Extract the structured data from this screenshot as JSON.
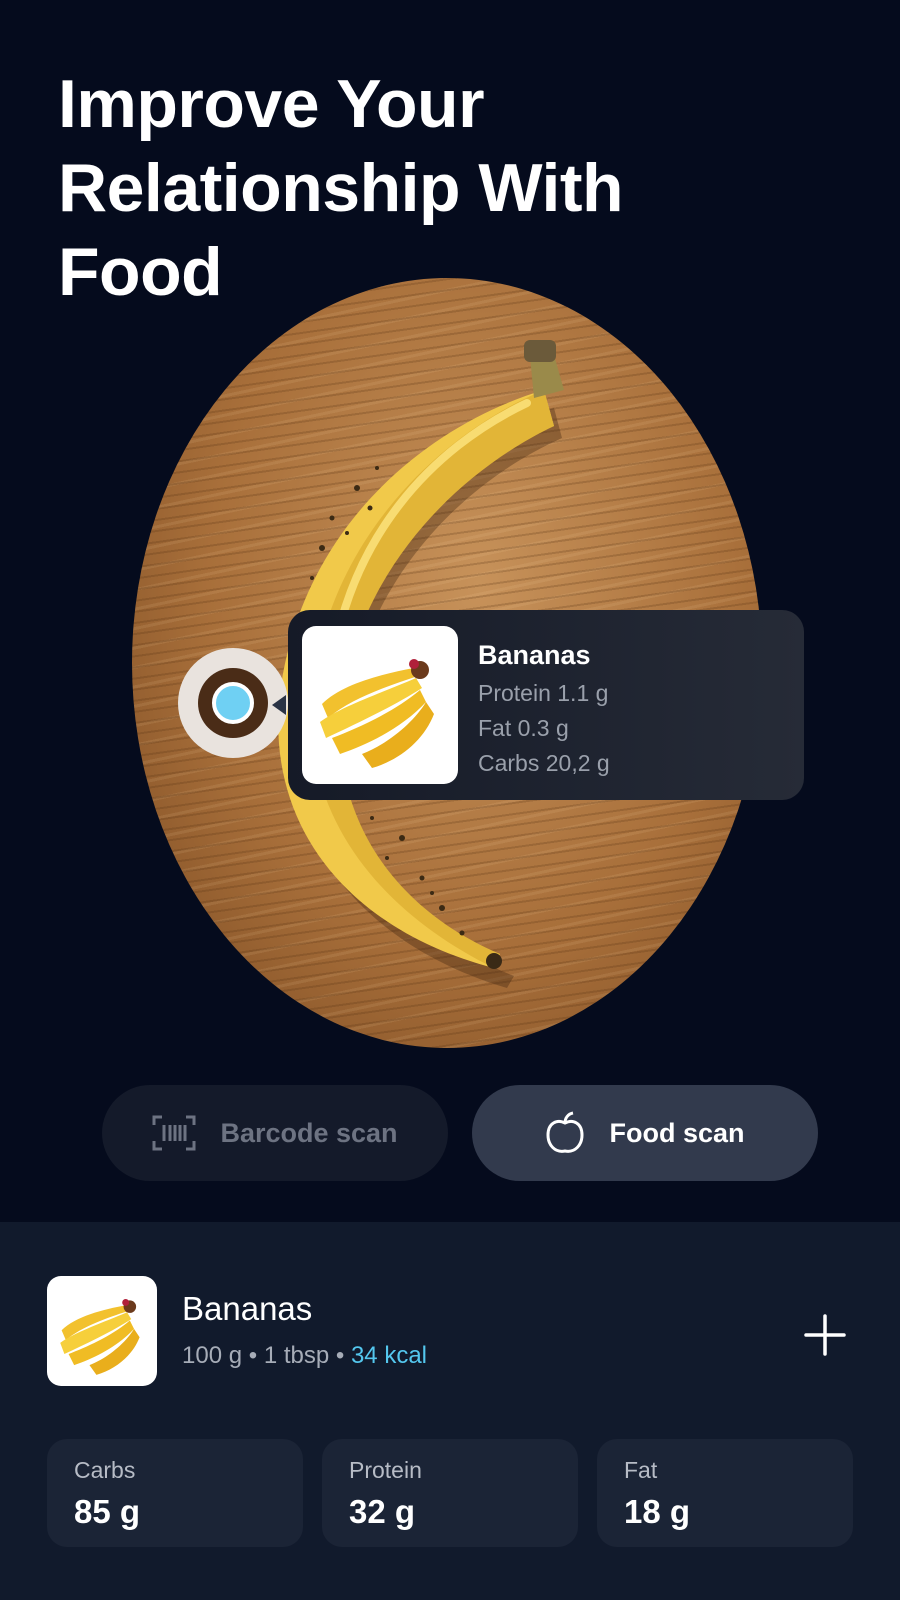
{
  "headline": {
    "line1": "Improve Your",
    "line2": "Relationship With",
    "line3": "Food"
  },
  "photo": {
    "subject_icon": "banana-photo"
  },
  "popup": {
    "name": "Bananas",
    "protein": "Protein 1.1 g",
    "fat": "Fat 0.3 g",
    "carbs": "Carbs 20,2 g",
    "thumb_icon": "bananas-bunch-icon"
  },
  "scan_modes": {
    "barcode": {
      "label": "Barcode scan",
      "icon": "barcode-scan-icon",
      "active": false
    },
    "food": {
      "label": "Food scan",
      "icon": "apple-icon",
      "active": true
    }
  },
  "item": {
    "name": "Bananas",
    "weight": "100 g",
    "portion": "1 tbsp",
    "kcal": "34 kcal",
    "separator": "•",
    "add_icon": "plus-icon"
  },
  "macros": [
    {
      "label": "Carbs",
      "value": "85 g"
    },
    {
      "label": "Protein",
      "value": "32 g"
    },
    {
      "label": "Fat",
      "value": "18 g"
    }
  ],
  "colors": {
    "background": "#050b1d",
    "sheet": "#111a2c",
    "accent": "#54c7ee",
    "active_button": "#323a4d"
  }
}
